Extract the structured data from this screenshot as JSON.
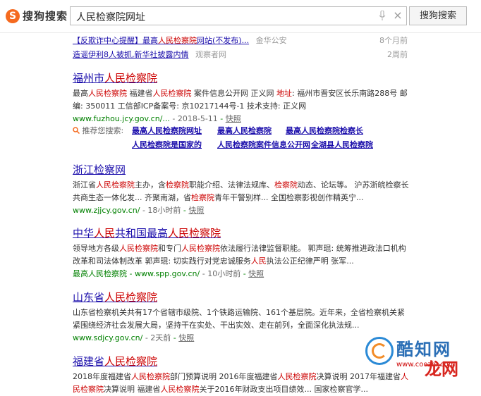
{
  "header": {
    "logo_text": "搜狗搜索",
    "logo_mark": "S",
    "query": "人民检察院网址",
    "search_button": "搜狗搜索",
    "clear_glyph": "×"
  },
  "news": [
    {
      "title": "【反欺诈中心提醒】最高人民检察院网站(不发布)...",
      "source": "金华公安",
      "time": "8个月前"
    },
    {
      "title": "造谣伊利8人被抓,新华社披露内情",
      "source": "观察者网",
      "time": "2周前"
    }
  ],
  "results": [
    {
      "title": "福州市人民检察院",
      "desc": "最高人民检察院 福建省人民检察院 案件信息公开网 正义网 地址: 福州市晋安区长乐南路288号 邮编: 350011 工信部ICP备案号: 京10217144号-1 技术支持: 正义网",
      "url": "www.fuzhou.jcy.gov.cn/...",
      "date": " - 2018-5-11",
      "snapshot": "快照"
    },
    {
      "title": "浙江检察网",
      "desc": "浙江省人民检察院主办，含检察院职能介绍、法律法规库、检察院动态、论坛等。 沪苏浙皖检察长共商生态一体化发... 齐聚南湖，省检察院青年干警别样... 全国检察影视创作精英宁...",
      "url": "www.zjjcy.gov.cn/",
      "date": " - 18小时前",
      "snapshot": "快照"
    },
    {
      "title": "中华人民共和国最高人民检察院",
      "desc": "领导地方各级人民检察院和专门人民检察院依法履行法律监督职能。 郭声琨: 统筹推进政法口机构改革和司法体制改革 郭声琨: 切实践行对党忠诚服务人民执法公正纪律严明 张军...",
      "url": "最高人民检察院 - www.spp.gov.cn/",
      "date": " - 10小时前",
      "snapshot": "快照"
    },
    {
      "title": "山东省人民检察院",
      "desc": "山东省检察机关共有17个省辖市级院、1个铁路运输院、161个基层院。近年来，全省检察机关紧紧围绕经济社会发展大局，坚持干在实处、干出实效、走在前列，全面深化执法规...",
      "url": "www.sdjcy.gov.cn/",
      "date": " - 2天前",
      "snapshot": "快照"
    },
    {
      "title": "福建省人民检察院",
      "desc": "2018年度福建省人民检察院部门预算说明 2016年度福建省人民检察院决算说明 2017年福建省人民检察院决算说明 福建省人民检察院关于2016年财政支出项目绩效... 国家检察官学..."
    }
  ],
  "recommendations": {
    "label": "推荐您搜索:",
    "items": [
      "最高人民检察院网址",
      "最高人民检察院",
      "最高人民检察院检察长",
      "人民检察院是国家的",
      "人民检察院案件信息公开网",
      "全湖县人民检察院"
    ]
  },
  "watermark": {
    "brand1": "酷知网",
    "brand2": "龙网",
    "url": "www.coozhi.com"
  },
  "colors": {
    "link": "#1a0dab",
    "highlight": "#cc0000",
    "url_green": "#008000",
    "logo_orange": "#f56a1f"
  }
}
